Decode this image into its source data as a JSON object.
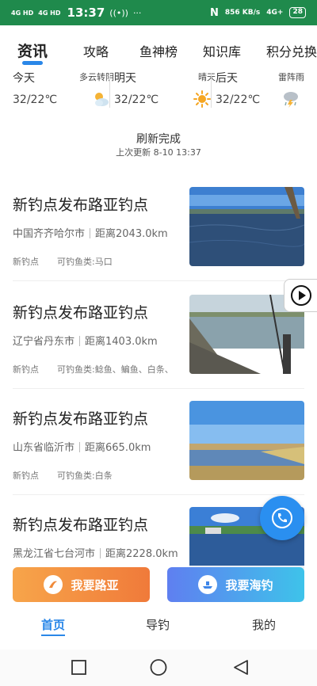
{
  "status_bar": {
    "signal1": "4G HD",
    "signal2": "4G HD",
    "time": "13:37",
    "hotspot": "((•))",
    "dots": "···",
    "nfc": "N",
    "speed": "856 KB/s",
    "net": "4G+",
    "battery": "28"
  },
  "tabs": [
    {
      "label": "资讯"
    },
    {
      "label": "攻略"
    },
    {
      "label": "鱼神榜"
    },
    {
      "label": "知识库"
    },
    {
      "label": "积分兑换"
    }
  ],
  "weather": [
    {
      "day": "今天",
      "condition": "多云转阴",
      "temp": "32/22℃",
      "icon": "cloudy-sun-icon"
    },
    {
      "day": "明天",
      "condition": "晴天",
      "temp": "32/22℃",
      "icon": "sun-icon"
    },
    {
      "day": "后天",
      "condition": "雷阵雨",
      "temp": "32/22℃",
      "icon": "thunderstorm-icon"
    }
  ],
  "refresh": {
    "title": "刷新完成",
    "time": "上次更新 8-10 13:37"
  },
  "items": [
    {
      "title": "新钓点发布路亚钓点",
      "location": "中国齐齐哈尔市",
      "distance": "距离2043.0km",
      "tag": "新钓点",
      "fish": "可钓鱼类:马口"
    },
    {
      "title": "新钓点发布路亚钓点",
      "location": "辽宁省丹东市",
      "distance": "距离1403.0km",
      "tag": "新钓点",
      "fish": "可钓鱼类:鲶鱼、鳊鱼、白条、"
    },
    {
      "title": "新钓点发布路亚钓点",
      "location": "山东省临沂市",
      "distance": "距离665.0km",
      "tag": "新钓点",
      "fish": "可钓鱼类:白条"
    },
    {
      "title": "新钓点发布路亚钓点",
      "location": "黑龙江省七台河市",
      "distance": "距离2228.0km"
    }
  ],
  "actions": {
    "lure": "我要路亚",
    "sea": "我要海钓"
  },
  "nav": [
    {
      "label": "首页"
    },
    {
      "label": "导钓"
    },
    {
      "label": "我的"
    }
  ]
}
